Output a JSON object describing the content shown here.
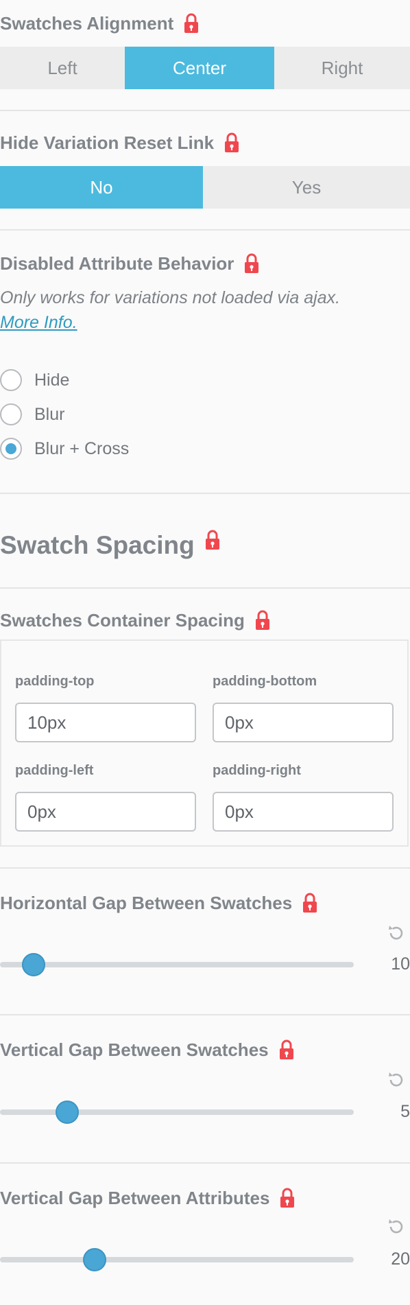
{
  "swatches_alignment": {
    "label": "Swatches Alignment",
    "options": [
      "Left",
      "Center",
      "Right"
    ],
    "selected": "Center"
  },
  "hide_reset": {
    "label": "Hide Variation Reset Link",
    "options": [
      "No",
      "Yes"
    ],
    "selected": "No"
  },
  "disabled_behavior": {
    "label": "Disabled Attribute Behavior",
    "note": "Only works for variations not loaded via ajax.",
    "link": "More Info.",
    "options": [
      "Hide",
      "Blur",
      "Blur + Cross"
    ],
    "selected": "Blur + Cross"
  },
  "swatch_spacing": {
    "title": "Swatch Spacing"
  },
  "container_spacing": {
    "label": "Swatches Container Spacing",
    "fields": {
      "top": {
        "label": "padding-top",
        "value": "10px"
      },
      "bottom": {
        "label": "padding-bottom",
        "value": "0px"
      },
      "left": {
        "label": "padding-left",
        "value": "0px"
      },
      "right": {
        "label": "padding-right",
        "value": "0px"
      }
    }
  },
  "sliders": {
    "horizontal_gap": {
      "label": "Horizontal Gap Between Swatches",
      "value": "10"
    },
    "vertical_gap": {
      "label": "Vertical Gap Between Swatches",
      "value": "5"
    },
    "attr_gap": {
      "label": "Vertical Gap Between Attributes",
      "value": "20"
    }
  },
  "colors": {
    "accent": "#4cbade",
    "lock": "#f0474e",
    "knob": "#4aa6d4"
  },
  "icons": {
    "lock": "lock-icon",
    "reset": "reset-icon"
  }
}
